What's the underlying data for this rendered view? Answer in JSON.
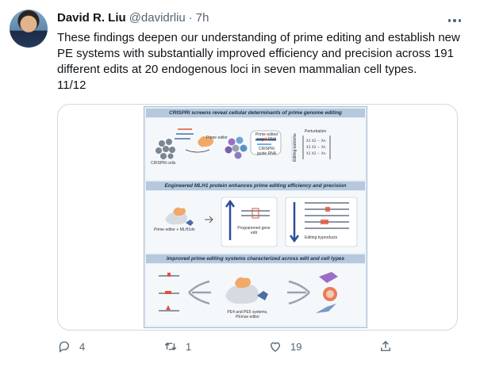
{
  "author": {
    "display_name": "David R. Liu",
    "handle": "@davidrliu",
    "separator": "·",
    "time": "7h"
  },
  "tweet": {
    "text": "These findings deepen our understanding of prime editing and establish new PE systems with substantially improved efficiency and precision across 191 different edits at 20 endogenous loci in seven mammalian cell types.\n11/12"
  },
  "figure": {
    "panel1": {
      "title": "CRISPRi screens reveal cellular determinants of prime genome editing",
      "labels": {
        "prime_editor": "Prime editor",
        "crispri_cells": "CRISPRi cells",
        "target_dna": "Prime edited target DNA",
        "guide_rna": "CRISPRi guide RNA",
        "perturbation": "Perturbation",
        "editing_outcome": "Editing outcome"
      }
    },
    "panel2": {
      "title": "Engineered MLH1 protein enhances prime editing efficiency and precision",
      "labels": {
        "editor_plus": "Prime editor + MLH1dn",
        "programmed": "Programmed gene edit",
        "byproducts": "Editing byproducts"
      }
    },
    "panel3": {
      "title": "Improved prime editing systems characterized across edit and cell types",
      "labels": {
        "systems": "PE4 and PE5 systems, PEmax editor"
      }
    }
  },
  "actions": {
    "reply_count": "4",
    "retweet_count": "1",
    "like_count": "19"
  },
  "icons": [
    "more-icon",
    "reply-icon",
    "retweet-icon",
    "like-icon",
    "share-icon"
  ],
  "colors": {
    "text": "#0f1419",
    "secondary": "#536471",
    "border": "#cfd9de"
  }
}
